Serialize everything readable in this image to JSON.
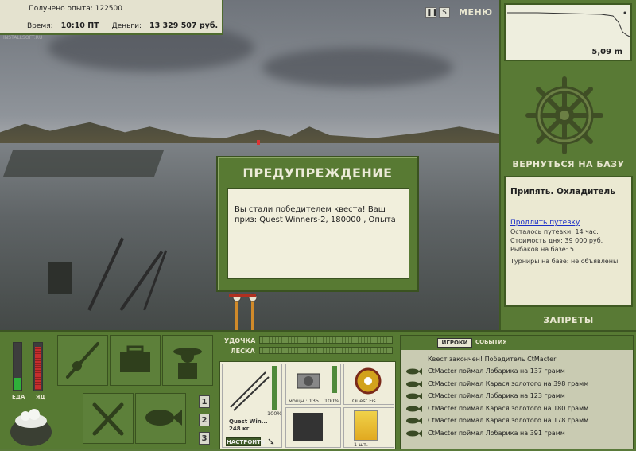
{
  "hud": {
    "experience_label": "Получено опыта:",
    "experience_value": "122500",
    "time_label": "Время:",
    "time_value": "10:10 ПТ",
    "money_label": "Деньги:",
    "money_value": "13 329 507 руб.",
    "watermark": "INSTALLSOFT.RU"
  },
  "top_controls": {
    "pause_icon": "pause-icon",
    "sound_label": "S",
    "menu_label": "МЕНЮ"
  },
  "depth": {
    "value": "5,09 m"
  },
  "right_panel": {
    "return_label": "ВЕРНУТЬСЯ НА БАЗУ",
    "location_title": "Припять. Охладитель",
    "extend_permit_link": "Продлить путевку",
    "permit_left": "Осталось путевки: 14 час.",
    "day_cost": "Стоимость дня: 39 000 руб.",
    "fishers_on_base": "Рыбаков на базе: 5",
    "tournaments": "Турниры на базе: не объявлены",
    "bans_label": "ЗАПРЕТЫ"
  },
  "dialog": {
    "title": "ПРЕДУПРЕЖДЕНИЕ",
    "message": "Вы стали победителем квеста! Ваш приз: Quest Winners-2, 180000 , Опыта"
  },
  "status_bars": {
    "food_label": "ЕДА",
    "poison_label": "ЯД",
    "food_level": 0.25,
    "poison_level": 0.9
  },
  "number_buttons": [
    "1",
    "2",
    "3"
  ],
  "meters": {
    "rod_label": "УДОЧКА",
    "line_label": "ЛЕСКА"
  },
  "tackle": {
    "rod_name": "Quest Win...",
    "rod_weight": "248 кг",
    "rod_percent": "100%",
    "reel_power": "мощн.: 135",
    "reel_percent": "100%",
    "line_name": "Quest Fis...",
    "bait_count": "1 шт.",
    "setup_button": "НАСТРОИТЬ"
  },
  "events_panel": {
    "tab_players": "ИГРОКИ",
    "tab_events": "СОБЫТИЯ",
    "header": "Квест закончен! Победитель CtMacter",
    "rows": [
      "CtMacter поймал Лобарика на 137 грамм",
      "CtMacter поймал Карася золотого на 398 грамм",
      "CtMacter поймал Лобарика на 123 грамм",
      "CtMacter поймал Карася золотого на 180 грамм",
      "CtMacter поймал Карася золотого на 178 грамм",
      "CtMacter поймал Лобарика на 391 грамм"
    ]
  },
  "colors": {
    "panel_green": "#597a35",
    "cream": "#efedda",
    "accent_text": "#e9e7d1",
    "link_blue": "#1a2ec7"
  }
}
